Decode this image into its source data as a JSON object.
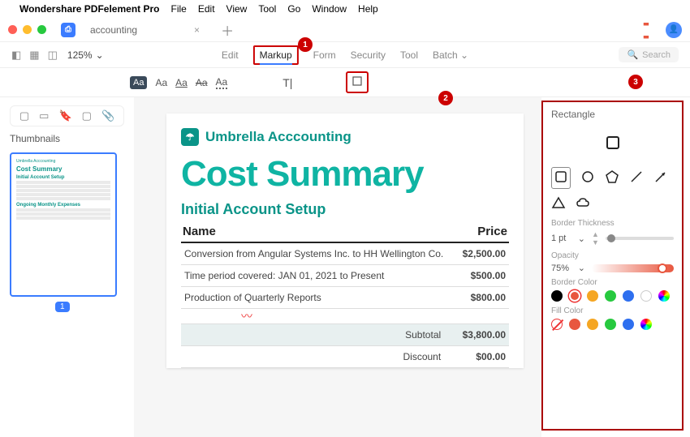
{
  "menubar": {
    "app": "Wondershare PDFelement Pro",
    "items": [
      "File",
      "Edit",
      "View",
      "Tool",
      "Go",
      "Window",
      "Help"
    ]
  },
  "tab": {
    "name": "accounting"
  },
  "zoom": "125%",
  "mainTabs": {
    "edit": "Edit",
    "markup": "Markup",
    "form": "Form",
    "security": "Security",
    "tool": "Tool",
    "batch": "Batch"
  },
  "search_placeholder": "Search",
  "sidebar": {
    "title": "Thumbnails",
    "page": "1"
  },
  "doc": {
    "brand": "Umbrella Acccounting",
    "title": "Cost Summary",
    "section": "Initial Account Setup",
    "th_name": "Name",
    "th_price": "Price",
    "rows": [
      {
        "name": "Conversion from Angular Systems Inc. to HH Wellington Co.",
        "price": "$2,500.00"
      },
      {
        "name": "Time period covered: JAN 01, 2021 to Present",
        "price": "$500.00"
      },
      {
        "name": "Production of Quarterly Reports",
        "price": "$800.00"
      }
    ],
    "subtotal_label": "Subtotal",
    "subtotal": "$3,800.00",
    "discount_label": "Discount",
    "discount": "$00.00"
  },
  "thumb": {
    "brand": "Umbrella Acccounting",
    "title": "Cost Summary",
    "s1": "Initial Account Setup",
    "s2": "Ongoing Monthly Expenses"
  },
  "props": {
    "title": "Rectangle",
    "border_thickness_label": "Border Thickness",
    "border_thickness": "1 pt",
    "opacity_label": "Opacity",
    "opacity": "75%",
    "border_color_label": "Border Color",
    "fill_color_label": "Fill Color"
  },
  "callouts": {
    "c1": "1",
    "c2": "2",
    "c3": "3"
  }
}
